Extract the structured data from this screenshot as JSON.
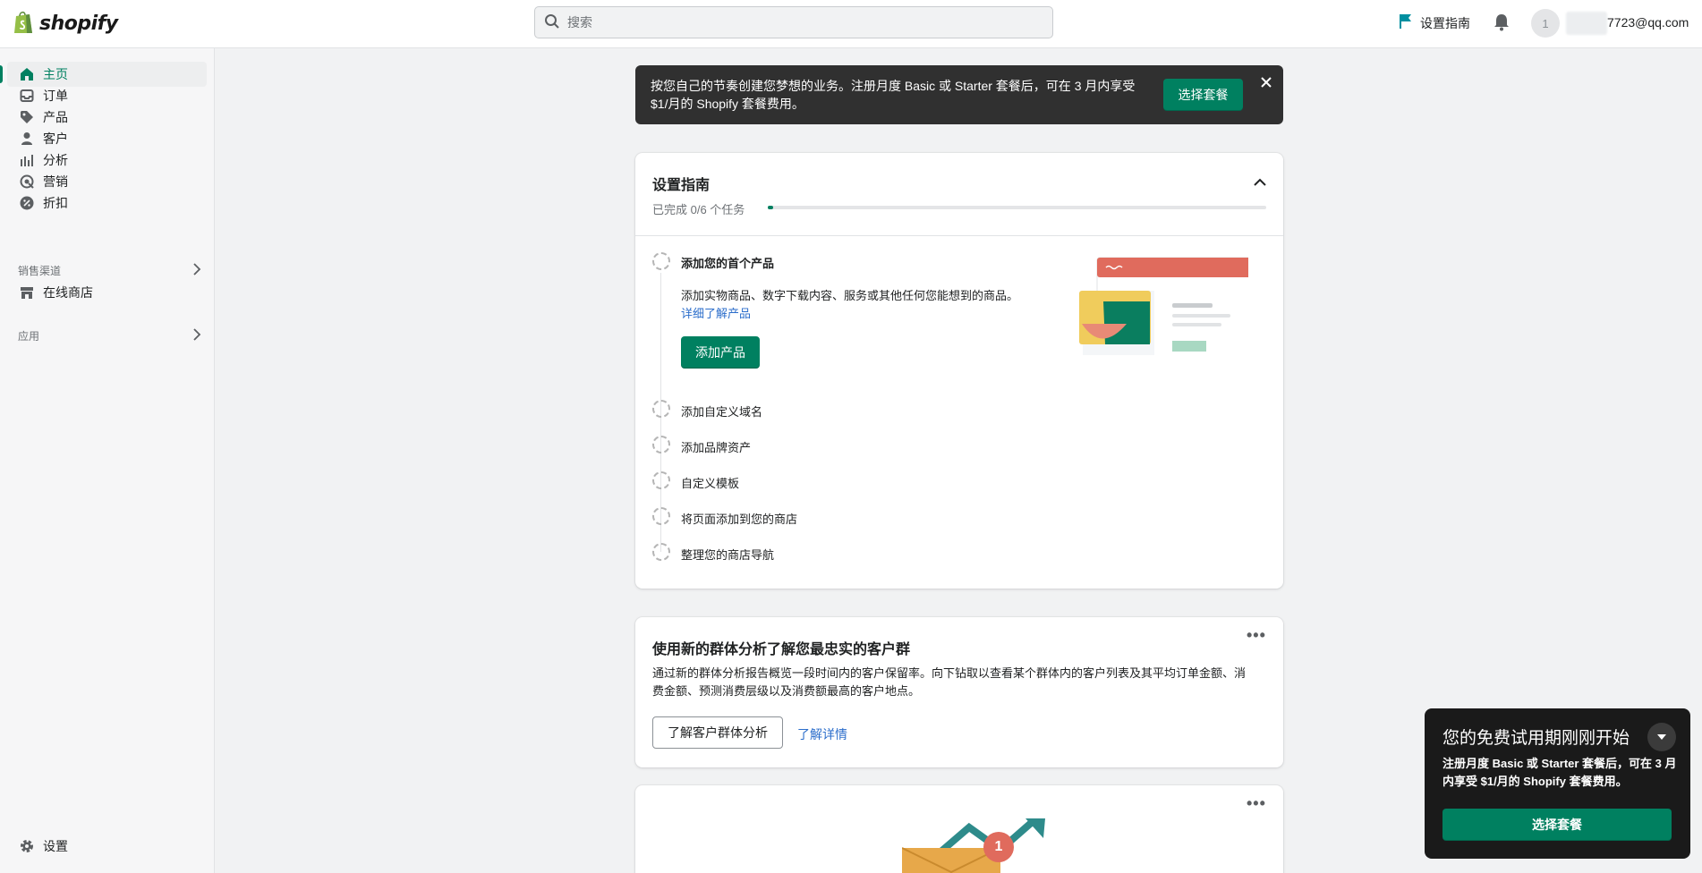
{
  "header": {
    "logo_text": "shopify",
    "search_placeholder": "搜索",
    "setup_guide_label": "设置指南",
    "avatar_initial": "1",
    "account_email": "7723@qq.com"
  },
  "sidebar": {
    "items": [
      {
        "label": "主页",
        "icon": "home-icon"
      },
      {
        "label": "订单",
        "icon": "inbox-icon"
      },
      {
        "label": "产品",
        "icon": "tag-icon"
      },
      {
        "label": "客户",
        "icon": "person-icon"
      },
      {
        "label": "分析",
        "icon": "bar-chart-icon"
      },
      {
        "label": "营销",
        "icon": "target-icon"
      },
      {
        "label": "折扣",
        "icon": "discount-icon"
      }
    ],
    "sales_channels_label": "销售渠道",
    "online_store_label": "在线商店",
    "apps_label": "应用",
    "settings_label": "设置"
  },
  "banner": {
    "text": "按您自己的节奏创建您梦想的业务。注册月度 Basic 或 Starter 套餐后，可在 3 月内享受 $1/月的 Shopify 套餐费用。",
    "button_label": "选择套餐",
    "close_icon": "close-icon"
  },
  "setup_guide": {
    "title": "设置指南",
    "progress_text": "已完成 0/6 个任务",
    "progress_fraction": 0.0,
    "tasks": [
      {
        "label": "添加您的首个产品"
      },
      {
        "label": "添加自定义域名"
      },
      {
        "label": "添加品牌资产"
      },
      {
        "label": "自定义模板"
      },
      {
        "label": "将页面添加到您的商店"
      },
      {
        "label": "整理您的商店导航"
      }
    ],
    "first_task_desc": "添加实物商品、数字下载内容、服务或其他任何您能想到的商品。",
    "first_task_link": "详细了解产品",
    "first_task_button": "添加产品"
  },
  "cohort_card": {
    "title": "使用新的群体分析了解您最忠实的客户群",
    "desc": "通过新的群体分析报告概览一段时间内的客户保留率。向下钻取以查看某个群体内的客户列表及其平均订单金额、消费金额、预测消费层级以及消费额最高的客户地点。",
    "button_label": "了解客户群体分析",
    "link_label": "了解详情"
  },
  "third_card": {
    "badge_count": "1"
  },
  "trial_popup": {
    "title": "您的免费试用期刚刚开始",
    "desc": "注册月度 Basic 或 Starter 套餐后，可在 3 月内享受 $1/月的 Shopify 套餐费用。",
    "button_label": "选择套餐"
  },
  "colors": {
    "brand_green": "#008060",
    "banner_bg": "#303030",
    "link_blue": "#2c6ecb"
  }
}
